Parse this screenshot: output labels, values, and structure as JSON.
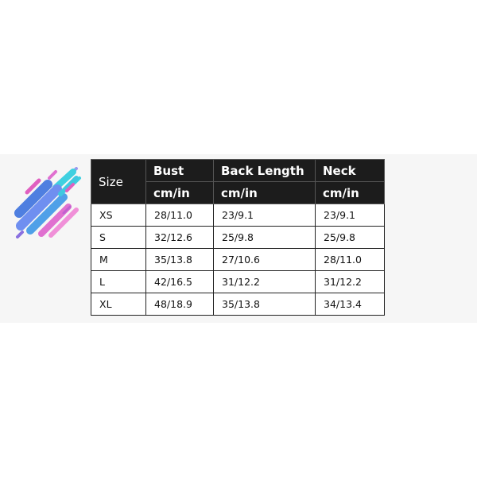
{
  "table": {
    "size_header": "Size",
    "columns": [
      {
        "label": "Bust",
        "unit": "cm/in"
      },
      {
        "label": "Back Length",
        "unit": "cm/in"
      },
      {
        "label": "Neck",
        "unit": "cm/in"
      }
    ],
    "rows": [
      {
        "size": "XS",
        "bust": "28/11.0",
        "back_length": "23/9.1",
        "neck": "23/9.1"
      },
      {
        "size": "S",
        "bust": "32/12.6",
        "back_length": "25/9.8",
        "neck": "25/9.8"
      },
      {
        "size": "M",
        "bust": "35/13.8",
        "back_length": "27/10.6",
        "neck": "28/11.0"
      },
      {
        "size": "L",
        "bust": "42/16.5",
        "back_length": "31/12.2",
        "neck": "31/12.2"
      },
      {
        "size": "XL",
        "bust": "48/18.9",
        "back_length": "35/13.8",
        "neck": "34/13.4"
      }
    ]
  },
  "decoration": {
    "icon": "paint-streaks-icon",
    "colors": [
      "#4f7fe0",
      "#6fa0f0",
      "#3fd0e0",
      "#e060c0",
      "#f080d0",
      "#9a70e0",
      "#c060d0"
    ]
  }
}
